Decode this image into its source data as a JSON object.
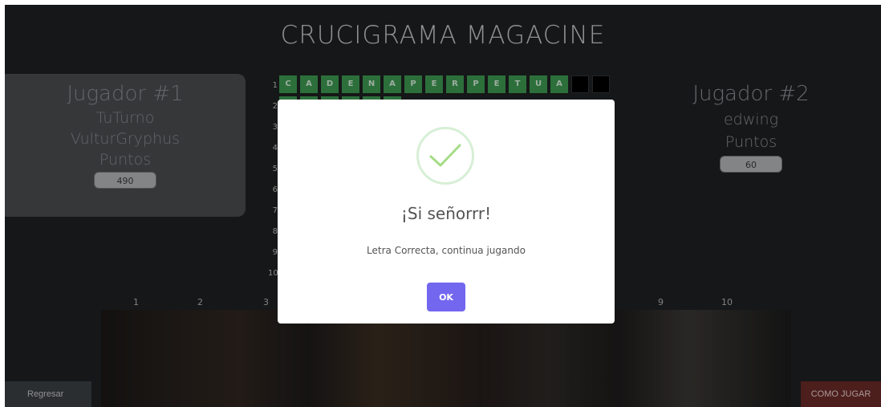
{
  "page": {
    "title": "CRUCIGRAMA MAGACINE"
  },
  "player1": {
    "title": "Jugador #1",
    "turn": "TuTurno",
    "name": "VulturGryphus",
    "points_label": "Puntos",
    "points": "490"
  },
  "player2": {
    "title": "Jugador #2",
    "name": "edwing",
    "points_label": "Puntos",
    "points": "60"
  },
  "grid": {
    "row_numbers": [
      "1",
      "2",
      "3",
      "4",
      "5",
      "6",
      "7",
      "8",
      "9",
      "10"
    ],
    "row1_letters": [
      "C",
      "A",
      "D",
      "E",
      "N",
      "A",
      "P",
      "E",
      "R",
      "P",
      "E",
      "T",
      "U",
      "A",
      "",
      ""
    ],
    "column_numbers": [
      "1",
      "2",
      "3",
      "9",
      "10"
    ]
  },
  "buttons": {
    "back": "Regresar",
    "how_to_play": "COMO JUGAR"
  },
  "modal": {
    "title": "¡Si señorrr!",
    "text": "Letra Correcta, continua jugando",
    "ok": "OK"
  },
  "colors": {
    "accent": "#7367f0",
    "cell_green": "#3d9a52",
    "success_check": "#a5dc86"
  }
}
